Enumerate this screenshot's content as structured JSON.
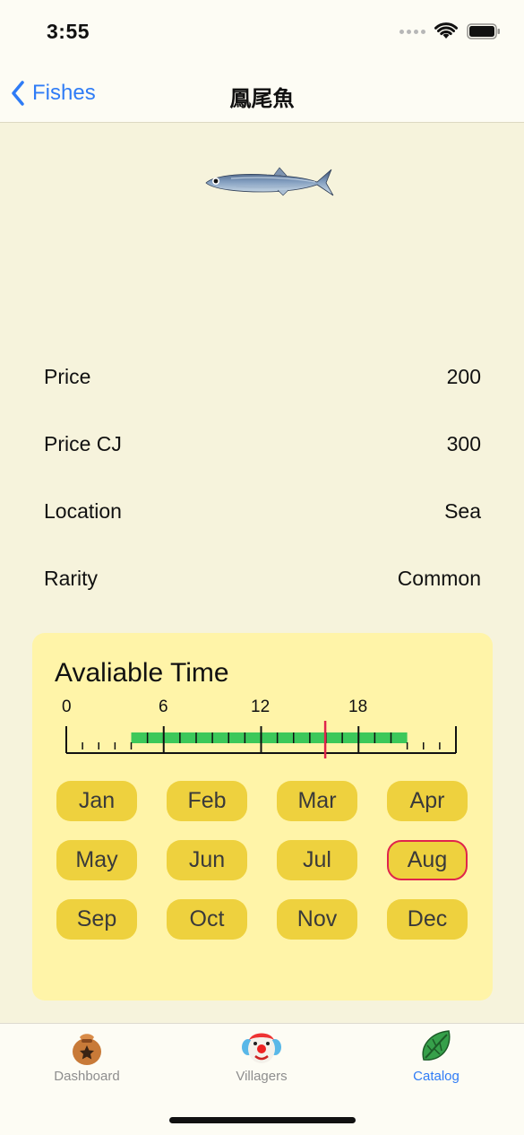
{
  "status_bar": {
    "time": "3:55"
  },
  "nav": {
    "back_label": "Fishes",
    "title": "鳳尾魚"
  },
  "details": [
    {
      "label": "Price",
      "value": "200"
    },
    {
      "label": "Price CJ",
      "value": "300"
    },
    {
      "label": "Location",
      "value": "Sea"
    },
    {
      "label": "Rarity",
      "value": "Common"
    }
  ],
  "available_time": {
    "title": "Avaliable Time",
    "hour_labels": [
      "0",
      "6",
      "12",
      "18"
    ],
    "available_from_hour": 4,
    "available_to_hour": 21,
    "current_hour": 15.95,
    "months": [
      "Jan",
      "Feb",
      "Mar",
      "Apr",
      "May",
      "Jun",
      "Jul",
      "Aug",
      "Sep",
      "Oct",
      "Nov",
      "Dec"
    ],
    "current_month": "Aug"
  },
  "tab_bar": {
    "tabs": [
      {
        "label": "Dashboard",
        "icon": "bell-bag-icon"
      },
      {
        "label": "Villagers",
        "icon": "villager-icon"
      },
      {
        "label": "Catalog",
        "icon": "leaf-icon"
      }
    ],
    "active_tab": "Catalog"
  },
  "colors": {
    "accent": "#2f7cf6",
    "background": "#f6f3dc",
    "card": "#fff4a8",
    "month_button": "#eed13e",
    "available_bar": "#3cc85a",
    "current_marker": "#e0244c"
  }
}
